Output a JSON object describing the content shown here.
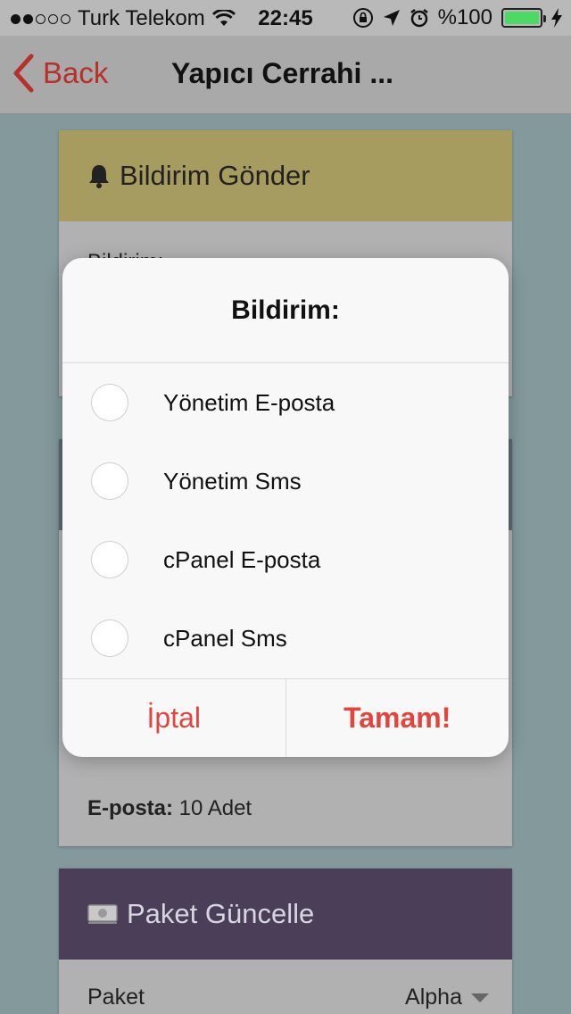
{
  "status_bar": {
    "carrier": "Turk Telekom",
    "time": "22:45",
    "battery": "%100",
    "signal_bars_filled": 2,
    "signal_bars_total": 5,
    "icons": [
      "wifi-icon",
      "orientation-lock-icon",
      "location-arrow-icon",
      "alarm-icon",
      "battery-icon",
      "charging-bolt-icon"
    ]
  },
  "nav": {
    "back_label": "Back",
    "title": "Yapıcı Cerrahi ..."
  },
  "notification_card": {
    "title": "Bildirim Gönder",
    "field_label": "Bildirim:",
    "icon": "bell-icon",
    "header_color": "#a79c60"
  },
  "quota_card": {
    "email_label": "E-posta:",
    "email_value": "10 Adet"
  },
  "package_card": {
    "title": "Paket Güncelle",
    "icon": "money-icon",
    "header_color": "#4a3e58",
    "field_label": "Paket",
    "selected_value": "Alpha"
  },
  "dialog": {
    "title": "Bildirim:",
    "options": [
      {
        "label": "Yönetim E-posta",
        "selected": false
      },
      {
        "label": "Yönetim Sms",
        "selected": false
      },
      {
        "label": "cPanel E-posta",
        "selected": false
      },
      {
        "label": "cPanel Sms",
        "selected": false
      }
    ],
    "cancel_label": "İptal",
    "ok_label": "Tamam!",
    "accent_color": "#e3453c"
  }
}
